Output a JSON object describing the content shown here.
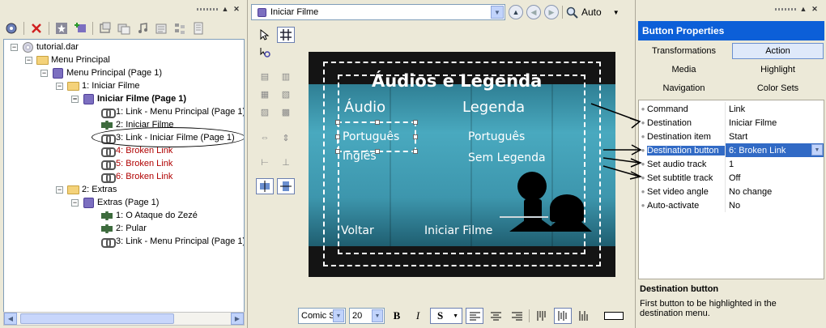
{
  "tree": {
    "items": [
      {
        "label": "tutorial.dar",
        "style": ""
      },
      {
        "label": "Menu Principal",
        "style": ""
      },
      {
        "label": "Menu Principal (Page 1)",
        "style": ""
      },
      {
        "label": "1: Iniciar Filme",
        "style": ""
      },
      {
        "label": "Iniciar Filme (Page 1)",
        "style": "bold"
      },
      {
        "label": "1: Link - Menu Principal (Page 1)",
        "style": ""
      },
      {
        "label": "2: Iniciar Filme",
        "style": ""
      },
      {
        "label": "3: Link - Iniciar Filme (Page 1)",
        "style": ""
      },
      {
        "label": "4: Broken Link",
        "style": "broken"
      },
      {
        "label": "5: Broken Link",
        "style": "broken"
      },
      {
        "label": "6: Broken Link",
        "style": "broken"
      },
      {
        "label": "2: Extras",
        "style": ""
      },
      {
        "label": "Extras (Page 1)",
        "style": ""
      },
      {
        "label": "1: O Ataque do Zezé",
        "style": ""
      },
      {
        "label": "2: Pular",
        "style": ""
      },
      {
        "label": "3: Link - Menu Principal (Page 1)",
        "style": ""
      }
    ]
  },
  "center": {
    "menu_select": "Iniciar Filme",
    "zoom": "Auto"
  },
  "canvas": {
    "title": "Áudios e Legenda",
    "audio_heading": "Áudio",
    "subtitle_heading": "Legenda",
    "audio_opt1": "Português",
    "audio_opt2": "Inglês",
    "sub_opt1": "Português",
    "sub_opt2": "Sem Legenda",
    "back": "Voltar",
    "start": "Iniciar Filme"
  },
  "format": {
    "font": "Comic S",
    "size": "20",
    "bold": "B",
    "italic": "I",
    "shadow": "S"
  },
  "properties": {
    "title": "Button Properties",
    "tabs": [
      "Transformations",
      "Action",
      "Media",
      "Highlight",
      "Navigation",
      "Color Sets"
    ],
    "rows": [
      {
        "name": "Command",
        "value": "Link"
      },
      {
        "name": "Destination",
        "value": "Iniciar Filme"
      },
      {
        "name": "Destination item",
        "value": "Start"
      },
      {
        "name": "Destination button",
        "value": "6: Broken Link"
      },
      {
        "name": "Set audio track",
        "value": "1"
      },
      {
        "name": "Set subtitle track",
        "value": "Off"
      },
      {
        "name": "Set video angle",
        "value": "No change"
      },
      {
        "name": "Auto-activate",
        "value": "No"
      }
    ],
    "desc_title": "Destination button",
    "desc_text": "First button to be highlighted in the destination menu."
  },
  "colors": {
    "accent": "#0c5fd8",
    "selection": "#316ac5",
    "broken": "#b00000"
  }
}
